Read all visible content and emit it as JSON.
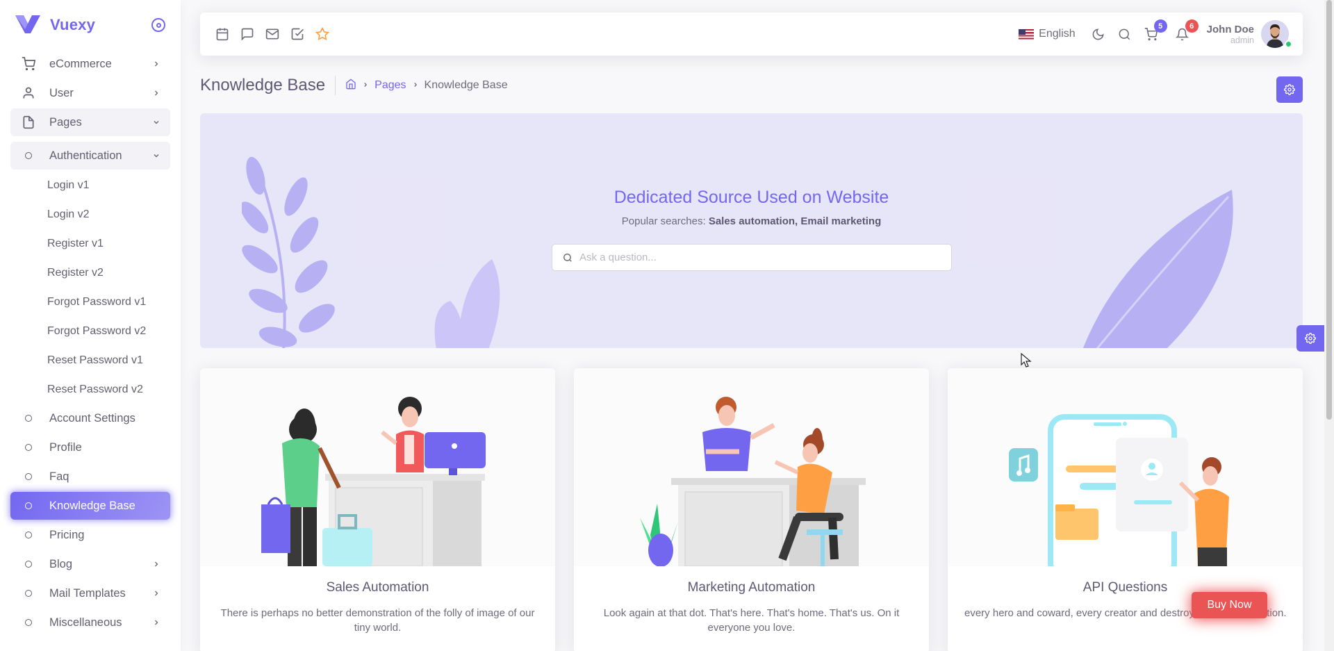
{
  "brand": {
    "name": "Vuexy"
  },
  "sidebar": {
    "items": [
      {
        "label": "eCommerce"
      },
      {
        "label": "User"
      },
      {
        "label": "Pages"
      },
      {
        "label": "Authentication"
      }
    ],
    "auth_sub": [
      "Login v1",
      "Login v2",
      "Register v1",
      "Register v2",
      "Forgot Password v1",
      "Forgot Password v2",
      "Reset Password v1",
      "Reset Password v2"
    ],
    "pages_items": [
      {
        "label": "Account Settings"
      },
      {
        "label": "Profile"
      },
      {
        "label": "Faq"
      },
      {
        "label": "Knowledge Base"
      },
      {
        "label": "Pricing"
      },
      {
        "label": "Blog"
      },
      {
        "label": "Mail Templates"
      },
      {
        "label": "Miscellaneous"
      }
    ]
  },
  "navbar": {
    "language": "English",
    "cart_count": "5",
    "notification_count": "6",
    "user_name": "John Doe",
    "user_role": "admin"
  },
  "header": {
    "title": "Knowledge Base",
    "breadcrumb": [
      "Pages",
      "Knowledge Base"
    ]
  },
  "hero": {
    "title": "Dedicated Source Used on Website",
    "popular_prefix": "Popular searches:",
    "popular_terms": "Sales automation, Email marketing",
    "search_placeholder": "Ask a question..."
  },
  "cards": [
    {
      "title": "Sales Automation",
      "text": "There is perhaps no better demonstration of the folly of image of our tiny world."
    },
    {
      "title": "Marketing Automation",
      "text": "Look again at that dot. That's here. That's home. That's us. On it everyone you love."
    },
    {
      "title": "API Questions",
      "text": "every hero and coward, every creator and destroyer of our civilization."
    }
  ],
  "buy_now": "Buy Now",
  "colors": {
    "primary": "#7367f0",
    "danger": "#ea5455",
    "success": "#28c76f"
  }
}
